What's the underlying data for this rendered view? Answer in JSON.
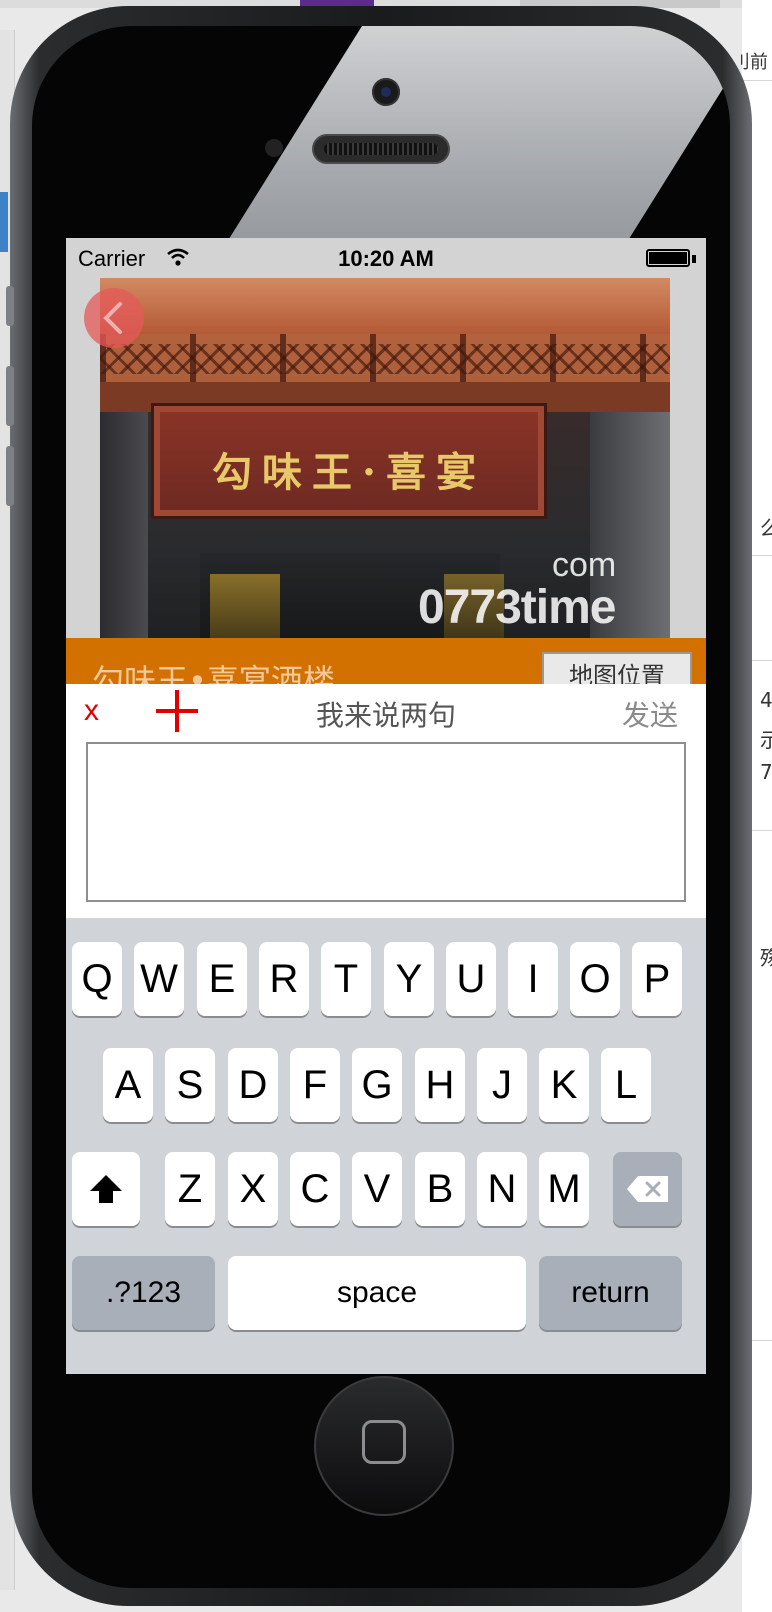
{
  "backdrop": {
    "right_fragments": [
      "刂前",
      "么",
      "4",
      "示",
      "7",
      "殇"
    ]
  },
  "status_bar": {
    "carrier": "Carrier",
    "time": "10:20 AM"
  },
  "hero": {
    "sign_text": "勾味王·喜宴",
    "watermark_top": "com",
    "watermark_main": "0773time"
  },
  "venue": {
    "title": "勾味王•喜宴酒楼",
    "map_button": "地图位置"
  },
  "comment_panel": {
    "close_label": "x",
    "title": "我来说两句",
    "send_label": "发送",
    "input_value": ""
  },
  "keyboard": {
    "row1": [
      "Q",
      "W",
      "E",
      "R",
      "T",
      "Y",
      "U",
      "I",
      "O",
      "P"
    ],
    "row2": [
      "A",
      "S",
      "D",
      "F",
      "G",
      "H",
      "J",
      "K",
      "L"
    ],
    "row3": [
      "Z",
      "X",
      "C",
      "V",
      "B",
      "N",
      "M"
    ],
    "numbers_label": ".?123",
    "space_label": "space",
    "return_label": "return"
  },
  "icons": {
    "back": "chevron-left-icon",
    "add": "plus-icon",
    "shift": "shift-arrow-icon",
    "delete": "backspace-icon",
    "wifi": "wifi-icon",
    "battery": "battery-icon"
  },
  "colors": {
    "title_bar": "#d27100",
    "accent_red": "#e00000",
    "keyboard_bg": "#d0d3d8"
  }
}
